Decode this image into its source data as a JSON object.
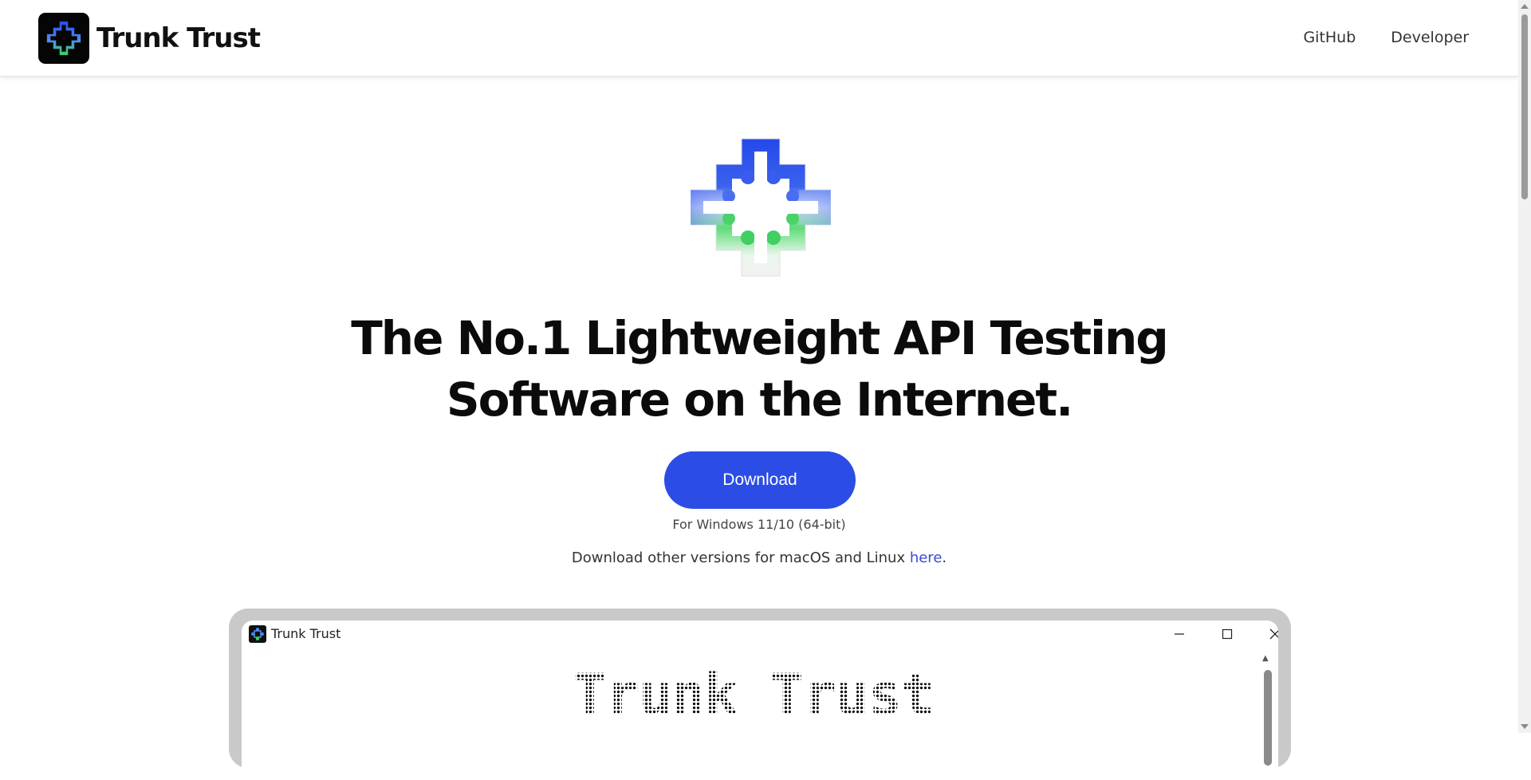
{
  "header": {
    "brand_name": "Trunk Trust",
    "nav": [
      {
        "label": "GitHub"
      },
      {
        "label": "Developer"
      }
    ]
  },
  "hero": {
    "headline_line1": "The No.1 Lightweight API Testing",
    "headline_line2": "Software on the Internet.",
    "download_label": "Download",
    "platform_note": "For Windows 11/10 (64-bit)",
    "other_versions_text": "Download other versions for macOS and Linux ",
    "other_versions_link": "here",
    "other_versions_suffix": "."
  },
  "preview": {
    "window_title": "Trunk Trust",
    "app_heading": "Trunk Trust"
  },
  "colors": {
    "accent": "#2b4de6",
    "link": "#3b49d8",
    "logo_blue": "#2a4de8",
    "logo_green": "#3bd15a"
  }
}
